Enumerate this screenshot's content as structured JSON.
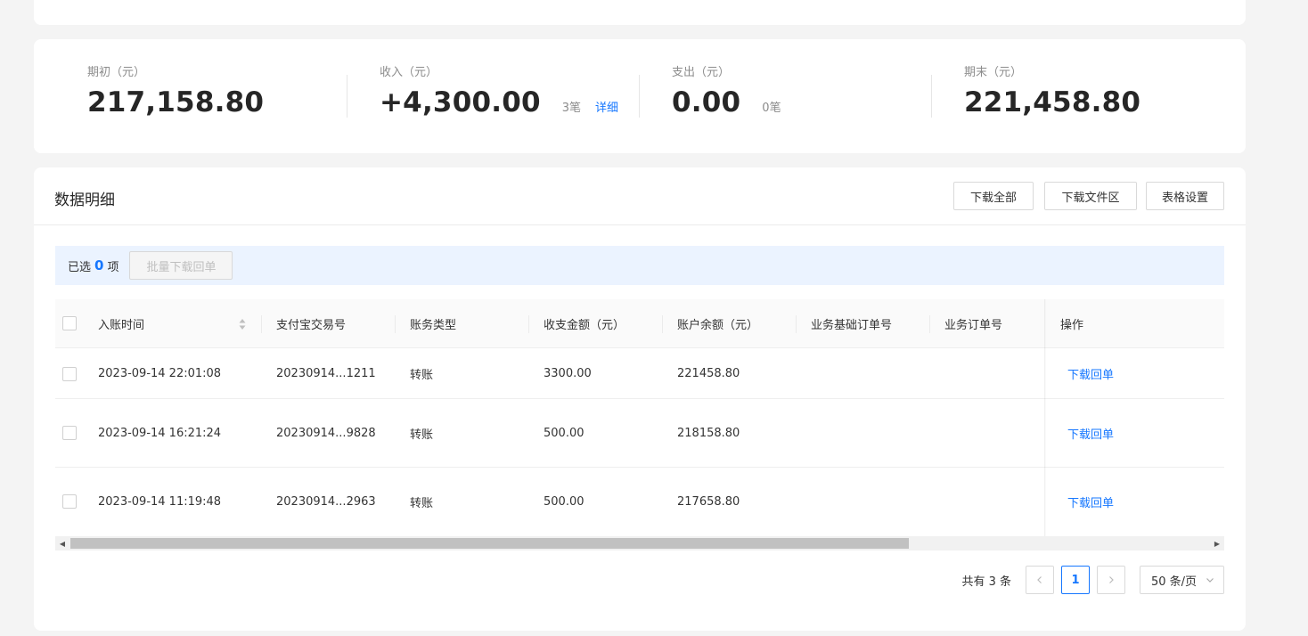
{
  "summary": {
    "opening": {
      "label": "期初（元）",
      "value": "217,158.80"
    },
    "income": {
      "label": "收入（元）",
      "value": "+4,300.00",
      "count": "3笔",
      "detail_link": "详细"
    },
    "expense": {
      "label": "支出（元）",
      "value": "0.00",
      "count": "0笔"
    },
    "closing": {
      "label": "期末（元）",
      "value": "221,458.80"
    }
  },
  "detail": {
    "title": "数据明细",
    "buttons": {
      "download_all": "下载全部",
      "download_area": "下载文件区",
      "table_settings": "表格设置"
    },
    "selection": {
      "prefix": "已选",
      "count": "0",
      "suffix": "项",
      "batch_button": "批量下载回单"
    },
    "columns": [
      "入账时间",
      "支付宝交易号",
      "账务类型",
      "收支金额（元）",
      "账户余额（元）",
      "业务基础订单号",
      "业务订单号",
      "操作"
    ],
    "rows": [
      {
        "time": "2023-09-14 22:01:08",
        "trade_no": "20230914...1211",
        "type": "转账",
        "amount": "3300.00",
        "balance": "221458.80",
        "base_order": "",
        "order": "",
        "action": "下载回单"
      },
      {
        "time": "2023-09-14 16:21:24",
        "trade_no": "20230914...9828",
        "type": "转账",
        "amount": "500.00",
        "balance": "218158.80",
        "base_order": "",
        "order": "",
        "action": "下载回单"
      },
      {
        "time": "2023-09-14 11:19:48",
        "trade_no": "20230914...2963",
        "type": "转账",
        "amount": "500.00",
        "balance": "217658.80",
        "base_order": "",
        "order": "",
        "action": "下载回单"
      }
    ],
    "pagination": {
      "total": "共有 3 条",
      "current_page": "1",
      "page_size": "50 条/页"
    }
  },
  "colors": {
    "accent": "#1677ff",
    "selection_bg": "#ebf3ff"
  }
}
